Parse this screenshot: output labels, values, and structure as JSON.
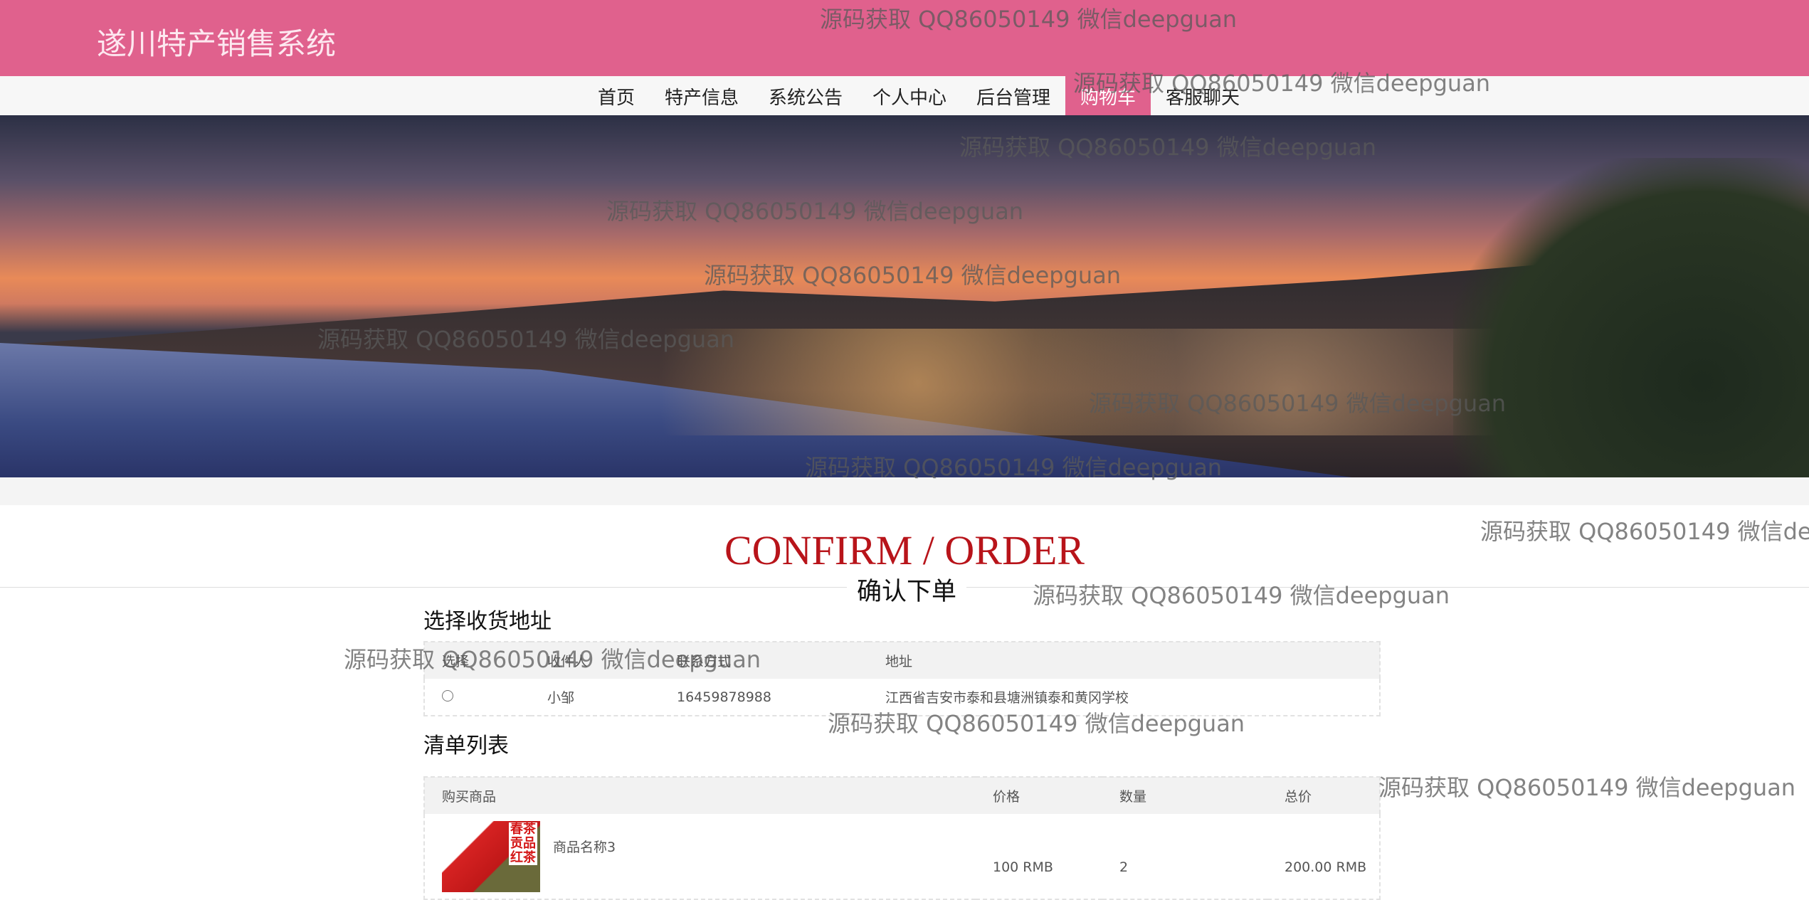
{
  "header": {
    "title": "遂川特产销售系统"
  },
  "nav": {
    "items": [
      "首页",
      "特产信息",
      "系统公告",
      "个人中心",
      "后台管理",
      "购物车",
      "客服聊天"
    ],
    "active": "购物车"
  },
  "page": {
    "title": "CONFIRM / ORDER",
    "subtitle": "确认下单"
  },
  "address": {
    "title": "选择收货地址",
    "columns": [
      "选择",
      "收件人",
      "联系方式",
      "地址"
    ],
    "rows": [
      {
        "selected": false,
        "name": "小邹",
        "phone": "16459878988",
        "address": "江西省吉安市泰和县塘洲镇泰和黄冈学校"
      }
    ]
  },
  "order": {
    "title": "清单列表",
    "columns": [
      "购买商品",
      "价格",
      "数量",
      "总价"
    ],
    "rows": [
      {
        "image_text": "春茶贡品红茶",
        "name": "商品名称3",
        "price": "100 RMB",
        "qty": "2",
        "total": "200.00 RMB"
      }
    ]
  },
  "watermark": "源码获取 QQ86050149 微信deepguan",
  "colors": {
    "brand": "#e0618d",
    "title_red": "#b8141a"
  }
}
